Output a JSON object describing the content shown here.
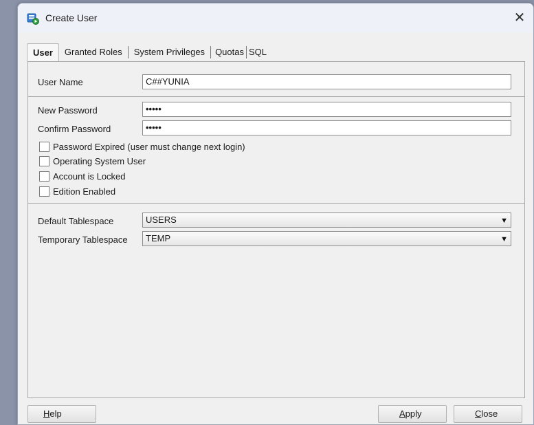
{
  "window": {
    "title": "Create User",
    "close_glyph": "✕",
    "icon": "database-user-icon",
    "accent_color": "#1e7fd6"
  },
  "tabs": [
    {
      "label": "User",
      "active": true
    },
    {
      "label": "Granted Roles",
      "active": false
    },
    {
      "label": "System Privileges",
      "active": false
    },
    {
      "label": "Quotas",
      "active": false
    },
    {
      "label": "SQL",
      "active": false
    }
  ],
  "form": {
    "user_name_label": "User Name",
    "user_name_value": "C##YUNIA",
    "new_password_label": "New Password",
    "new_password_value": "•••••",
    "confirm_password_label": "Confirm Password",
    "confirm_password_value": "•••••",
    "checkboxes": [
      {
        "label": "Password Expired (user must change next login)",
        "checked": false
      },
      {
        "label": "Operating System User",
        "checked": false
      },
      {
        "label": "Account is Locked",
        "checked": false
      },
      {
        "label": "Edition Enabled",
        "checked": false
      }
    ],
    "default_tablespace_label": "Default Tablespace",
    "default_tablespace_value": "USERS",
    "temporary_tablespace_label": "Temporary Tablespace",
    "temporary_tablespace_value": "TEMP",
    "dropdown_arrow": "▼"
  },
  "buttons": {
    "help": {
      "mnemonic": "H",
      "rest": "elp"
    },
    "apply": {
      "mnemonic": "A",
      "rest": "pply"
    },
    "close": {
      "mnemonic": "C",
      "rest": "lose"
    }
  }
}
